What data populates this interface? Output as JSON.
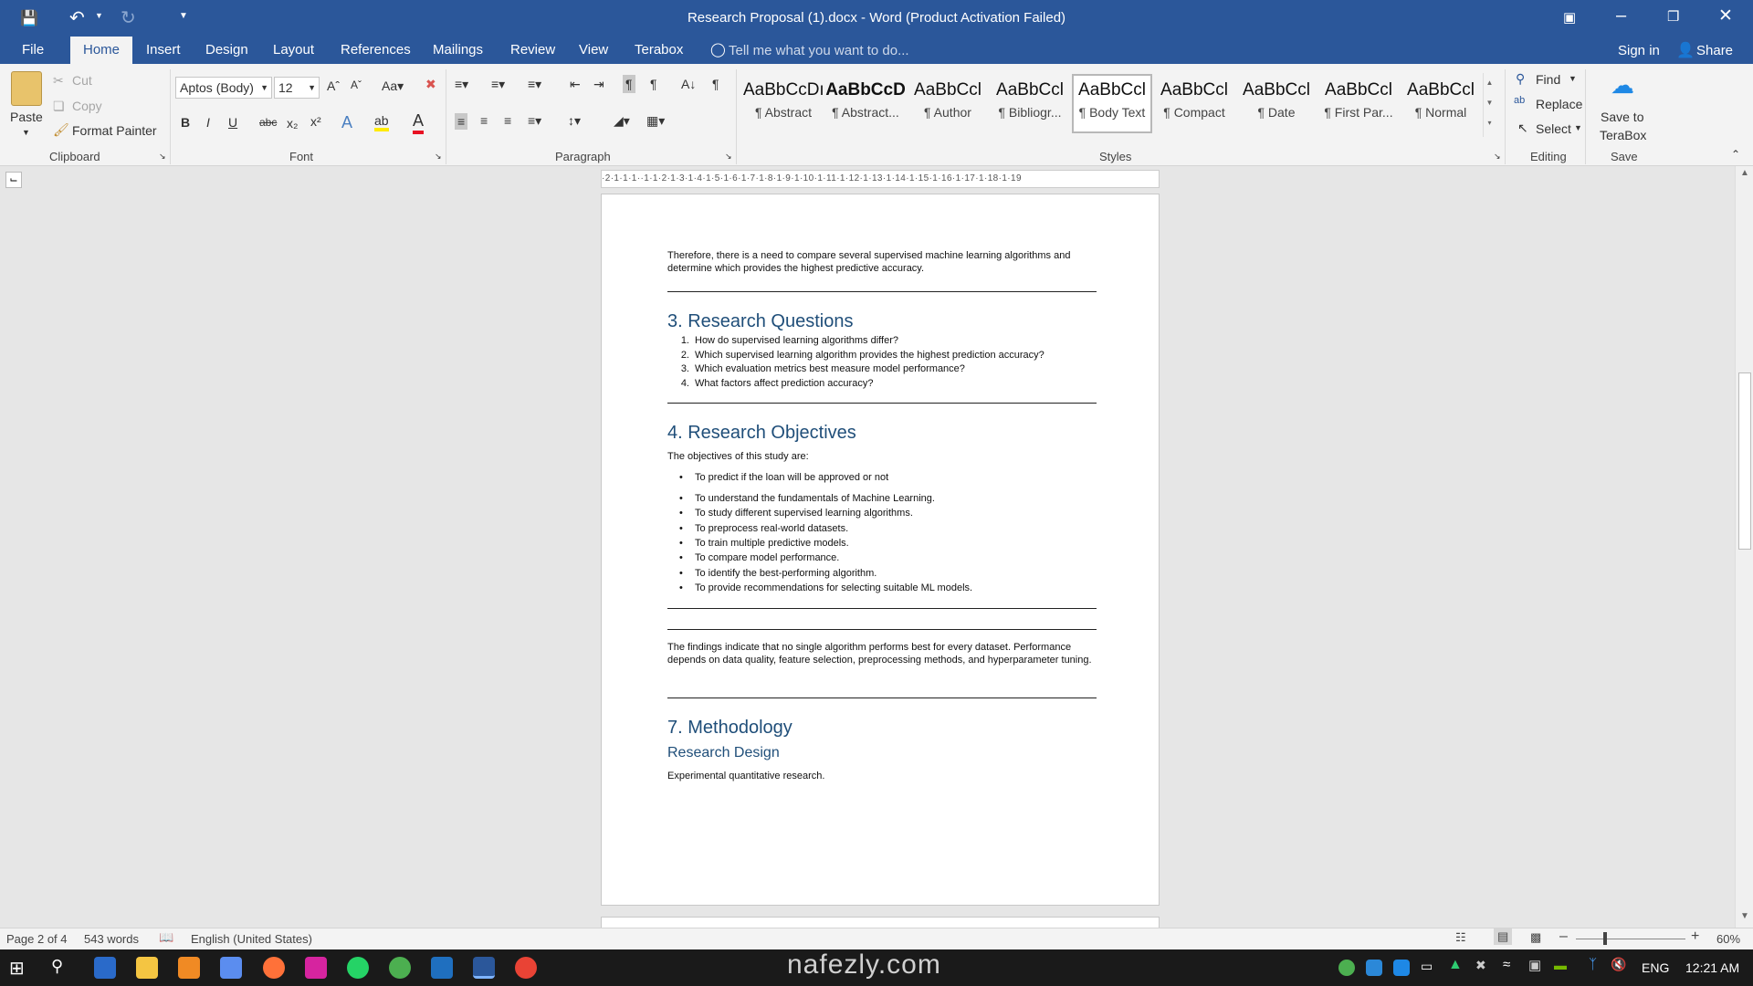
{
  "window": {
    "title": "Research Proposal (1).docx - Word (Product Activation Failed)"
  },
  "tabs": [
    "File",
    "Home",
    "Insert",
    "Design",
    "Layout",
    "References",
    "Mailings",
    "Review",
    "View",
    "Terabox"
  ],
  "tell_me": "Tell me what you want to do...",
  "account": {
    "signin": "Sign in",
    "share": "Share"
  },
  "clipboard": {
    "paste": "Paste",
    "cut": "Cut",
    "copy": "Copy",
    "format_painter": "Format Painter",
    "label": "Clipboard"
  },
  "font": {
    "name": "Aptos (Body)",
    "size": "12",
    "label": "Font"
  },
  "paragraph": {
    "label": "Paragraph"
  },
  "styles": {
    "label": "Styles",
    "items": [
      {
        "sample": "AaBbCcDı",
        "name": "¶ Abstract"
      },
      {
        "sample": "AaBbCcD",
        "name": "¶ Abstract..."
      },
      {
        "sample": "AaBbCcl",
        "name": "¶ Author"
      },
      {
        "sample": "AaBbCcl",
        "name": "¶ Bibliogr..."
      },
      {
        "sample": "AaBbCcl",
        "name": "¶ Body Text"
      },
      {
        "sample": "AaBbCcl",
        "name": "¶ Compact"
      },
      {
        "sample": "AaBbCcl",
        "name": "¶ Date"
      },
      {
        "sample": "AaBbCcl",
        "name": "¶ First Par..."
      },
      {
        "sample": "AaBbCcl",
        "name": "¶ Normal"
      }
    ]
  },
  "editing": {
    "find": "Find",
    "replace": "Replace",
    "select": "Select",
    "label": "Editing"
  },
  "save": {
    "save_to": "Save to",
    "terabox": "TeraBox",
    "label": "Save"
  },
  "ruler": "·2·1·1·1··1·1·2·1·3·1·4·1·5·1·6·1·7·1·8·1·9·1·10·1·11·1·12·1·13·1·14·1·15·1·16·1·17·1·18·1·19",
  "doc": {
    "intro": "Therefore, there is a need to compare several supervised machine learning algorithms and determine which provides the highest predictive accuracy.",
    "h3": "3. Research Questions",
    "questions": [
      {
        "n": "1.",
        "t": "How do supervised learning algorithms differ?"
      },
      {
        "n": "2.",
        "t": "Which supervised learning algorithm provides the highest prediction accuracy?"
      },
      {
        "n": "3.",
        "t": "Which evaluation metrics best measure model performance?"
      },
      {
        "n": "4.",
        "t": "What factors affect prediction accuracy?"
      }
    ],
    "h4": "4. Research Objectives",
    "obj_intro": "The objectives of this study are:",
    "objectives": [
      "To predict if the loan will be approved or not",
      "To understand the fundamentals of Machine Learning.",
      "To study different supervised learning algorithms.",
      "To preprocess real-world datasets.",
      "To train multiple predictive models.",
      "To compare model performance.",
      "To identify the best-performing algorithm.",
      "To provide recommendations for selecting suitable ML models."
    ],
    "findings": "The findings indicate that no single algorithm performs best for every dataset. Performance depends on data quality, feature selection, preprocessing methods, and hyperparameter tuning.",
    "h7": "7. Methodology",
    "h7sub": "Research Design",
    "design": "Experimental quantitative research."
  },
  "status": {
    "page": "Page 2 of 4",
    "words": "543 words",
    "lang": "English (United States)",
    "zoom": "60%"
  },
  "taskbar": {
    "lang": "ENG",
    "time": "12:21 AM"
  },
  "watermark": "nafezly.com"
}
